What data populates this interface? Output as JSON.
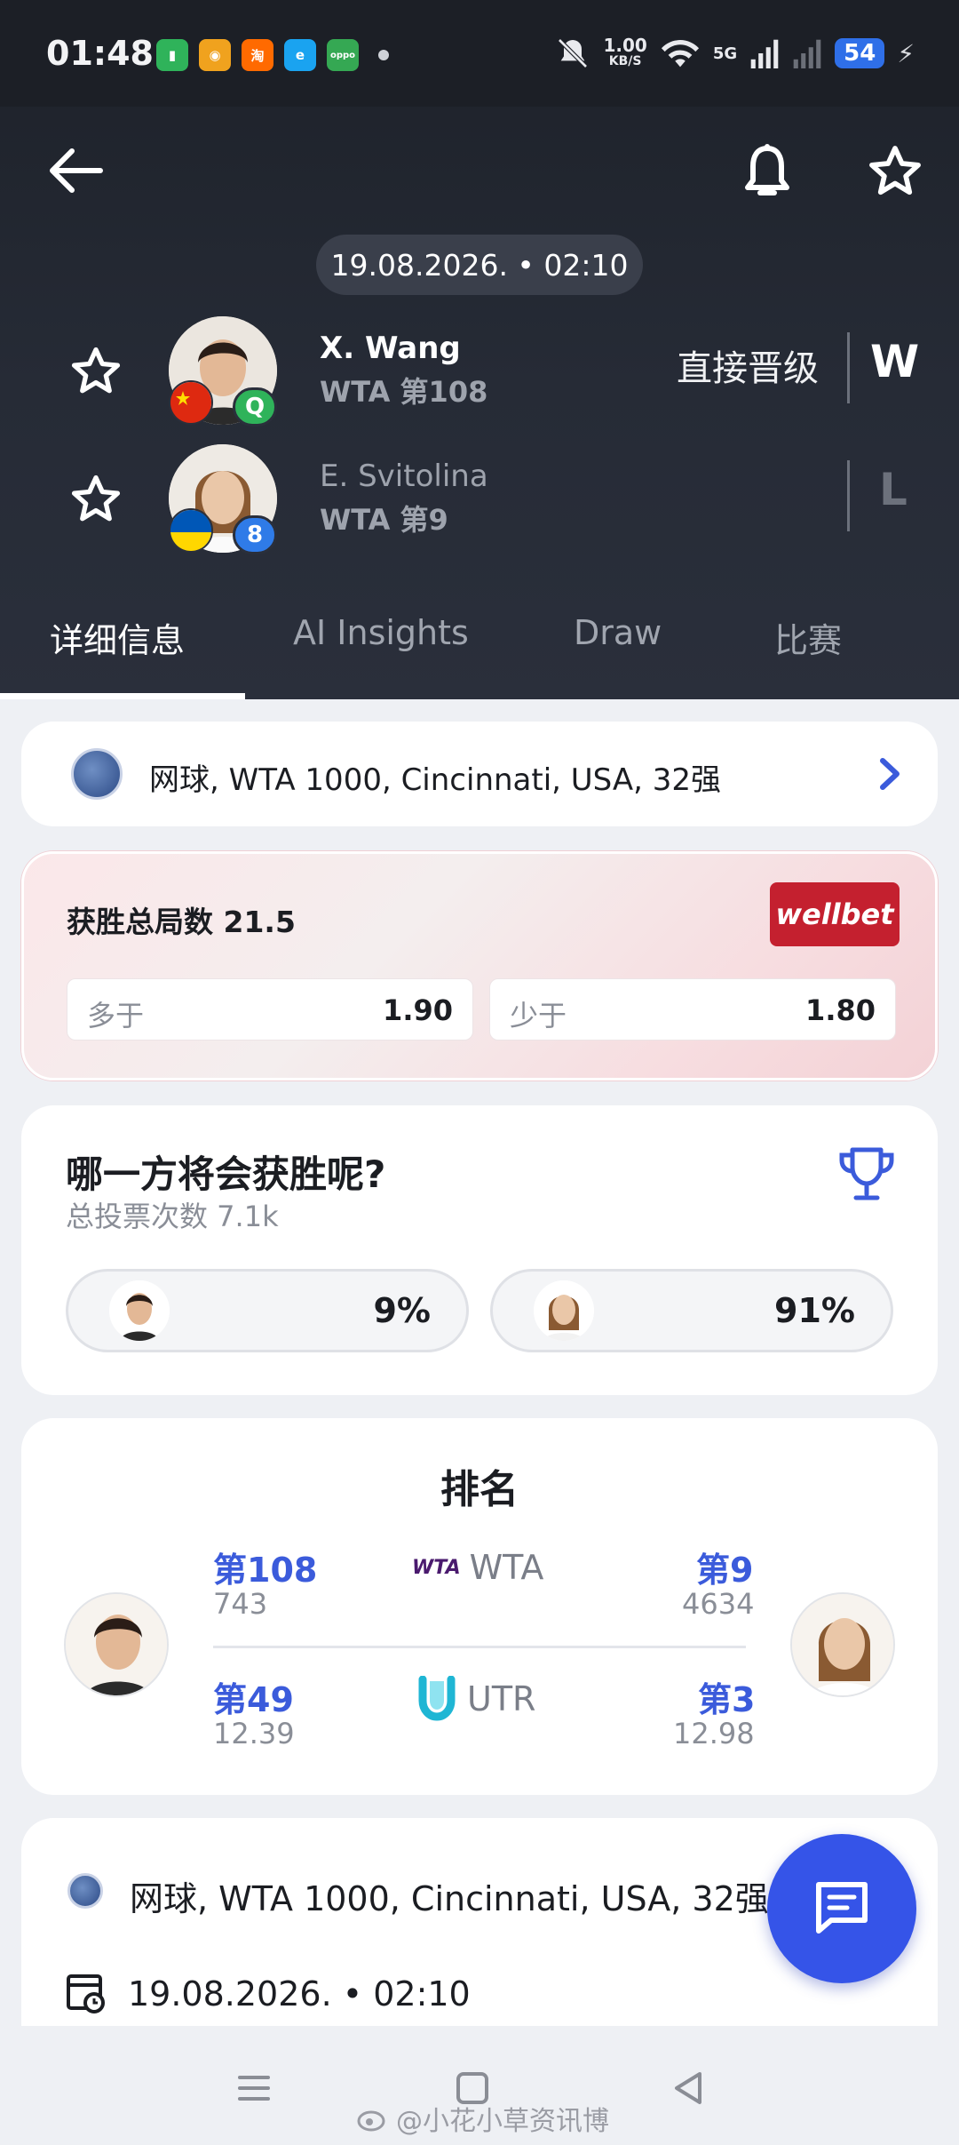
{
  "status_bar": {
    "time": "01:48",
    "speed": "1.00",
    "speed_unit": "KB/S",
    "network": "5G",
    "battery": "54",
    "apps": [
      "battery-saver-app-icon",
      "weibo-app-icon",
      "taobao-app-icon",
      "browser-app-icon",
      "oppo-app-icon"
    ]
  },
  "header": {
    "date_time": "19.08.2026. • 02:10"
  },
  "players": [
    {
      "name": "X. Wang",
      "rank": "WTA 第108",
      "badge": "Q",
      "badge_color": "#2fb35a",
      "flag": "china-flag-icon",
      "status": "直接晋级",
      "result": "W"
    },
    {
      "name": "E. Svitolina",
      "rank": "WTA 第9",
      "badge": "8",
      "badge_color": "#2f7be8",
      "flag": "ukraine-flag-icon",
      "status": "",
      "result": "L"
    }
  ],
  "tabs": [
    "详细信息",
    "AI Insights",
    "Draw",
    "比赛"
  ],
  "tournament": {
    "label": "网球, WTA 1000, Cincinnati, USA, 32强"
  },
  "odds": {
    "title": "获胜总局数 21.5",
    "bookmaker": "wellbet",
    "bookmaker_color": "#c4202f",
    "over_label": "多于",
    "over_value": "1.90",
    "under_label": "少于",
    "under_value": "1.80"
  },
  "vote": {
    "question": "哪一方将会获胜呢?",
    "total": "总投票次数 7.1k",
    "left_pct": "9%",
    "right_pct": "91%"
  },
  "ranking": {
    "title": "排名",
    "wta_label": "WTA",
    "wta_logo": "WTA",
    "utr_label": "UTR",
    "left_wta_rank": "第108",
    "left_wta_points": "743",
    "right_wta_rank": "第9",
    "right_wta_points": "4634",
    "left_utr_rank": "第49",
    "left_utr_value": "12.39",
    "right_utr_rank": "第3",
    "right_utr_value": "12.98"
  },
  "info": {
    "tournament": "网球, WTA 1000, Cincinnati, USA, 32强",
    "date_time": "19.08.2026. • 02:10"
  },
  "watermark": "@小花小草资讯博",
  "colors": {
    "accent": "#3b5bdb",
    "fab": "#3554e8"
  }
}
